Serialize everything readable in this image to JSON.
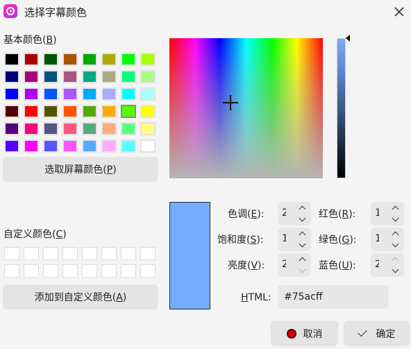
{
  "window": {
    "title": "选择字幕颜色"
  },
  "basic_colors": {
    "label": "基本颜色(",
    "mnemonic": "B",
    "label_end": ")",
    "swatches": [
      "#000000",
      "#aa0000",
      "#005500",
      "#aa5500",
      "#00aa00",
      "#aaaa00",
      "#00ff00",
      "#aaff00",
      "#00007f",
      "#aa007f",
      "#00557f",
      "#aa557f",
      "#00aa7f",
      "#aaaa7f",
      "#00ff7f",
      "#aaff7f",
      "#0000ff",
      "#aa00ff",
      "#0055ff",
      "#aa55ff",
      "#00aaff",
      "#aaaaff",
      "#00ffff",
      "#aaffff",
      "#550000",
      "#ff0000",
      "#555500",
      "#ff5500",
      "#55aa00",
      "#ffaa00",
      "#55ff00",
      "#ffff00",
      "#55007f",
      "#ff007f",
      "#55557f",
      "#ff557f",
      "#55aa7f",
      "#ffaa7f",
      "#55ff7f",
      "#ffff7f",
      "#5500ff",
      "#ff00ff",
      "#5555ff",
      "#ff55ff",
      "#55aaff",
      "#ffaaff",
      "#55ffff",
      "#ffffff"
    ],
    "selected_index": 30
  },
  "pick_screen": {
    "label": "选取屏幕颜色(",
    "mnemonic": "P",
    "label_end": ")"
  },
  "custom_colors": {
    "label": "自定义颜色(",
    "mnemonic": "C",
    "label_end": ")",
    "count": 16
  },
  "add_custom": {
    "label": "添加到自定义颜色(",
    "mnemonic": "A",
    "label_end": ")"
  },
  "fields": {
    "hue": {
      "label": "色调(",
      "mnemonic": "E",
      "label_end": "):",
      "value": "2"
    },
    "saturation": {
      "label": "饱和度(",
      "mnemonic": "S",
      "label_end": "):",
      "value": "1"
    },
    "value": {
      "label": "亮度(",
      "mnemonic": "V",
      "label_end": "):",
      "value": "2"
    },
    "red": {
      "label": "红色(",
      "mnemonic": "R",
      "label_end": "):",
      "value": "1"
    },
    "green": {
      "label": "绿色(",
      "mnemonic": "G",
      "label_end": "):",
      "value": "1"
    },
    "blue": {
      "label": "蓝色(",
      "mnemonic": "U",
      "label_end": "):",
      "value": "2"
    },
    "html": {
      "mnemonic": "H",
      "label_rest": "TML:",
      "value": "#75acff"
    }
  },
  "current_color": "#75acff",
  "buttons": {
    "cancel": "取消",
    "ok": "确定"
  },
  "icons": {
    "app": "video-player-icon",
    "close": "close-icon",
    "cancel": "record-dot-icon",
    "ok": "checkmark-icon"
  }
}
